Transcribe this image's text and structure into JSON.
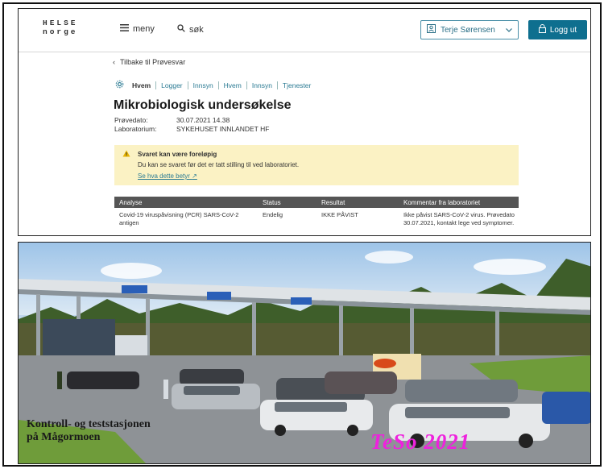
{
  "header": {
    "logo_line1": "HELSE",
    "logo_line2": "norge",
    "menu_label": "meny",
    "search_label": "søk",
    "user_name": "Terje Sørensen",
    "logout_label": "Logg ut"
  },
  "nav": {
    "back_label": "Tilbake til Prøvesvar"
  },
  "tabs": [
    "Hvem",
    "Logger",
    "Innsyn",
    "Hvem",
    "Innsyn",
    "Tjenester"
  ],
  "report": {
    "title": "Mikrobiologisk undersøkelse",
    "meta": [
      {
        "key": "Prøvedato:",
        "value": "30.07.2021 14.38"
      },
      {
        "key": "Laboratorium:",
        "value": "SYKEHUSET INNLANDET HF"
      }
    ]
  },
  "warning": {
    "heading": "Svaret kan være foreløpig",
    "body": "Du kan se svaret før det er tatt stilling til ved laboratoriet.",
    "link": "Se hva dette betyr"
  },
  "table": {
    "headers": [
      "Analyse",
      "Status",
      "Resultat",
      "Kommentar fra laboratoriet"
    ],
    "rows": [
      [
        "Covid-19 viruspåvisning (PCR) SARS-CoV-2 antigen",
        "Endelig",
        "IKKE PÅVIST",
        "Ikke påvist SARS-CoV-2 virus. Prøvedato 30.07.2021, kontakt lege ved symptomer."
      ]
    ]
  },
  "photo": {
    "caption_line1": "Kontroll- og teststasjonen",
    "caption_line2": "på Mågormoen",
    "stamp": "TeSo 2021"
  },
  "colors": {
    "primary": "#0e6f8f",
    "warning_bg": "#fbf2c4",
    "table_header": "#555555",
    "stamp": "#ee22dd"
  }
}
